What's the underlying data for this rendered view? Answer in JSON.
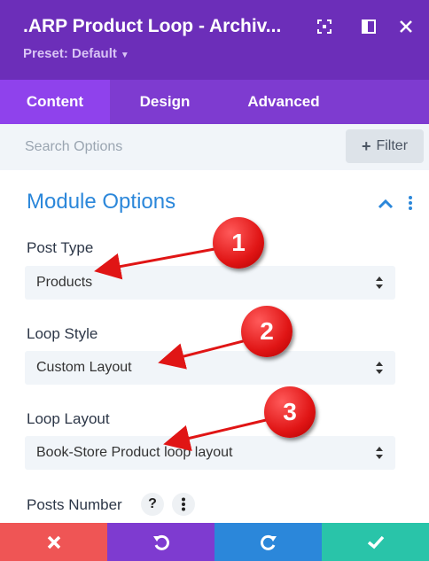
{
  "header": {
    "title": ".ARP Product Loop - Archiv...",
    "preset_label": "Preset: Default",
    "icons": [
      "focus-icon",
      "sidebar-layout-icon",
      "close-icon"
    ]
  },
  "tabs": [
    {
      "label": "Content",
      "active": true
    },
    {
      "label": "Design",
      "active": false
    },
    {
      "label": "Advanced",
      "active": false
    }
  ],
  "search": {
    "placeholder": "Search Options",
    "value": "",
    "filter_label": "Filter"
  },
  "module_options": {
    "title": "Module Options",
    "fields": [
      {
        "label": "Post Type",
        "value": "Products"
      },
      {
        "label": "Loop Style",
        "value": "Custom Layout"
      },
      {
        "label": "Loop Layout",
        "value": "Book-Store Product loop layout"
      },
      {
        "label": "Posts Number",
        "help": "?"
      }
    ]
  },
  "annotations": [
    {
      "number": "1",
      "points_to": "Post Type"
    },
    {
      "number": "2",
      "points_to": "Loop Style"
    },
    {
      "number": "3",
      "points_to": "Loop Layout"
    }
  ],
  "footer": {
    "buttons": [
      {
        "name": "discard",
        "icon": "close-icon",
        "color": "#ef5555"
      },
      {
        "name": "undo",
        "icon": "undo-icon",
        "color": "#7e3bd0"
      },
      {
        "name": "redo",
        "icon": "redo-icon",
        "color": "#2b87da"
      },
      {
        "name": "save",
        "icon": "check-icon",
        "color": "#29c4a9"
      }
    ]
  },
  "colors": {
    "header": "#6c2eb9",
    "tabs": "#7e3bd0",
    "tab_active": "#8f42ec",
    "section_title": "#2b87da",
    "annotation": "#e01515"
  }
}
